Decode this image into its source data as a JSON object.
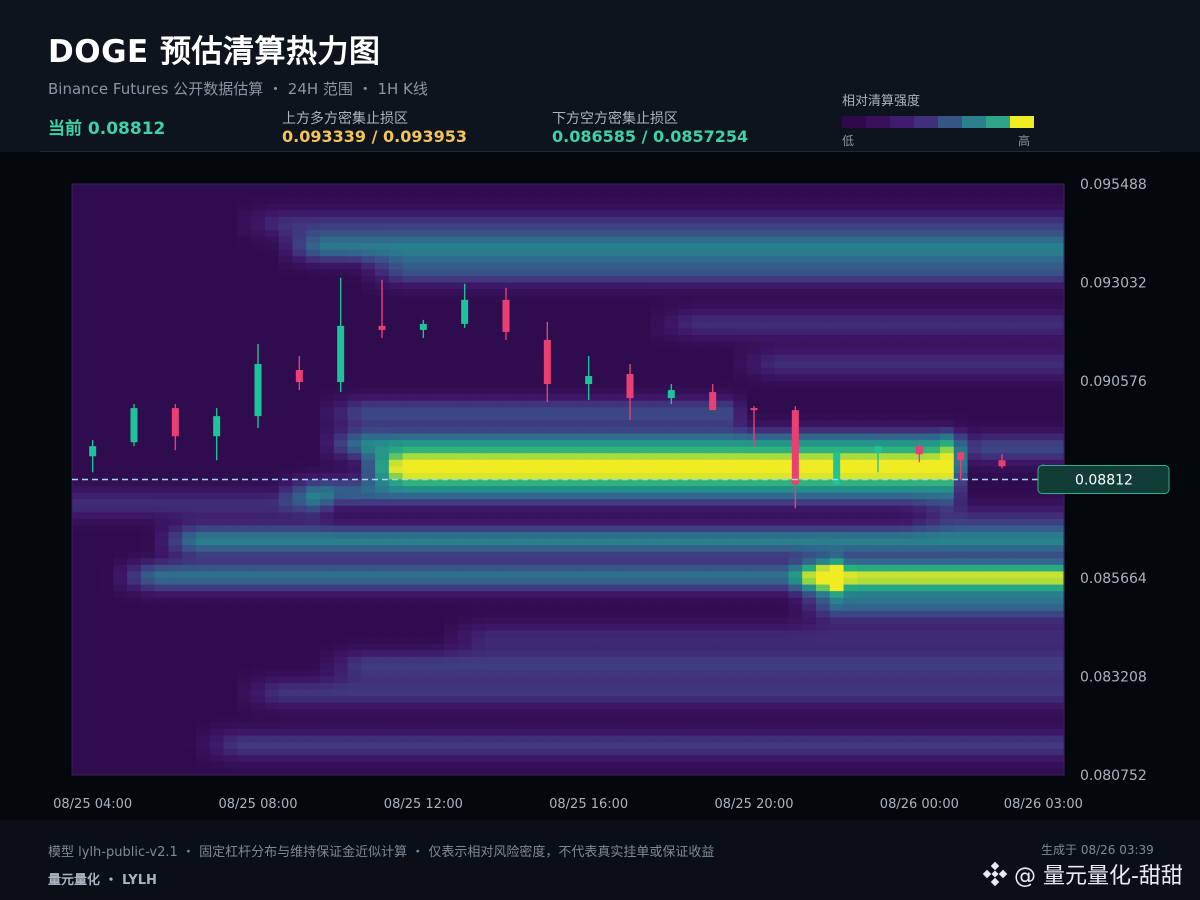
{
  "header": {
    "title": "DOGE 预估清算热力图",
    "subtitle": "Binance Futures 公开数据估算 ・ 24H 范围 ・ 1H K线",
    "current_label": "当前 0.08812",
    "upper_label": "上方多方密集止损区",
    "upper_value": "0.093339 / 0.093953",
    "lower_label": "下方空方密集止损区",
    "lower_value": "0.086585 / 0.0857254"
  },
  "legend": {
    "title": "相对清算强度",
    "low": "低",
    "high": "高",
    "colors": [
      "#2d0a4a",
      "#3a0f5c",
      "#411b6e",
      "#40307c",
      "#365584",
      "#2c7f8c",
      "#2fa488",
      "#f0ee22"
    ]
  },
  "footer": {
    "note": "模型 lylh-public-v2.1 ・ 固定杠杆分布与维持保证金近似计算 ・ 仅表示相对风险密度，不代表真实挂单或保证收益",
    "generated": "生成于 08/26 03:39",
    "brand": "量元量化 ・ LYLH",
    "watermark": "@ 量元量化-甜甜"
  },
  "colors": {
    "up": "#1fc39a",
    "down": "#ea3f72",
    "current_line": "#9fd7e6",
    "upper_value": "#f2c45a",
    "lower_value": "#3fd2a6",
    "price_tag_bg": "#123d36",
    "price_tag_border": "#2fb08e"
  },
  "chart_data": {
    "type": "heatmap",
    "x_ticks": [
      "08/25 04:00",
      "08/25 08:00",
      "08/25 12:00",
      "08/25 16:00",
      "08/25 20:00",
      "08/26 00:00",
      "08/26 03:00"
    ],
    "y_ticks": [
      "0.095488",
      "0.093032",
      "0.090576",
      "0.088120",
      "0.085664",
      "0.083208",
      "0.080752"
    ],
    "ylim": [
      0.080752,
      0.095488
    ],
    "current_price": 0.08812,
    "current_price_label": "0.08812",
    "heat_bands": [
      {
        "price": 0.0884,
        "amp": 1.0,
        "x_from": 8,
        "x_to": 21.3
      },
      {
        "price": 0.089,
        "amp": 0.55,
        "x_from": 7,
        "x_to": 21.3
      },
      {
        "price": 0.0878,
        "amp": 0.45,
        "x_from": 6,
        "x_to": 21.3
      },
      {
        "price": 0.0898,
        "amp": 0.35,
        "x_from": 7,
        "x_to": 16
      },
      {
        "price": 0.0857,
        "amp": 0.92,
        "x_from": 18.5,
        "x_to": 24
      },
      {
        "price": 0.0857,
        "amp": 0.5,
        "x_from": 2,
        "x_to": 18.5
      },
      {
        "price": 0.0866,
        "amp": 0.55,
        "x_from": 3,
        "x_to": 24
      },
      {
        "price": 0.085,
        "amp": 0.45,
        "x_from": 18.5,
        "x_to": 24
      },
      {
        "price": 0.0889,
        "amp": 0.35,
        "x_from": 22,
        "x_to": 24
      },
      {
        "price": 0.0939,
        "amp": 0.5,
        "x_from": 6,
        "x_to": 24
      },
      {
        "price": 0.0933,
        "amp": 0.35,
        "x_from": 8,
        "x_to": 24
      },
      {
        "price": 0.0945,
        "amp": 0.25,
        "x_from": 5,
        "x_to": 24
      },
      {
        "price": 0.092,
        "amp": 0.25,
        "x_from": 15,
        "x_to": 24
      },
      {
        "price": 0.091,
        "amp": 0.25,
        "x_from": 17,
        "x_to": 24
      },
      {
        "price": 0.0835,
        "amp": 0.3,
        "x_from": 7,
        "x_to": 24
      },
      {
        "price": 0.0828,
        "amp": 0.28,
        "x_from": 5,
        "x_to": 24
      },
      {
        "price": 0.0815,
        "amp": 0.3,
        "x_from": 4,
        "x_to": 24
      },
      {
        "price": 0.0842,
        "amp": 0.22,
        "x_from": 10,
        "x_to": 24
      },
      {
        "price": 0.0875,
        "amp": 0.25,
        "x_from": 0,
        "x_to": 6
      },
      {
        "price": 0.0872,
        "amp": 0.2,
        "x_from": 21.3,
        "x_to": 24
      }
    ],
    "candles": [
      {
        "o": 0.0887,
        "h": 0.0891,
        "l": 0.0883,
        "c": 0.08895
      },
      {
        "o": 0.08905,
        "h": 0.09,
        "l": 0.08895,
        "c": 0.0899
      },
      {
        "o": 0.0899,
        "h": 0.09,
        "l": 0.08885,
        "c": 0.0892
      },
      {
        "o": 0.0892,
        "h": 0.0899,
        "l": 0.0886,
        "c": 0.0897
      },
      {
        "o": 0.0897,
        "h": 0.0915,
        "l": 0.0894,
        "c": 0.091
      },
      {
        "o": 0.09085,
        "h": 0.0912,
        "l": 0.09035,
        "c": 0.09055
      },
      {
        "o": 0.09055,
        "h": 0.09315,
        "l": 0.0903,
        "c": 0.09195
      },
      {
        "o": 0.09195,
        "h": 0.0931,
        "l": 0.09165,
        "c": 0.09185
      },
      {
        "o": 0.09185,
        "h": 0.0921,
        "l": 0.09165,
        "c": 0.092
      },
      {
        "o": 0.092,
        "h": 0.093,
        "l": 0.0919,
        "c": 0.0926
      },
      {
        "o": 0.0926,
        "h": 0.0929,
        "l": 0.0916,
        "c": 0.0918
      },
      {
        "o": 0.0916,
        "h": 0.09205,
        "l": 0.09005,
        "c": 0.0905
      },
      {
        "o": 0.0905,
        "h": 0.0912,
        "l": 0.0901,
        "c": 0.0907
      },
      {
        "o": 0.09075,
        "h": 0.091,
        "l": 0.0896,
        "c": 0.09015
      },
      {
        "o": 0.09015,
        "h": 0.0905,
        "l": 0.09,
        "c": 0.09035
      },
      {
        "o": 0.0903,
        "h": 0.0905,
        "l": 0.0899,
        "c": 0.08985
      },
      {
        "o": 0.0899,
        "h": 0.08995,
        "l": 0.08895,
        "c": 0.08985
      },
      {
        "o": 0.08985,
        "h": 0.08995,
        "l": 0.0874,
        "c": 0.088
      },
      {
        "o": 0.088,
        "h": 0.0888,
        "l": 0.088,
        "c": 0.0888
      },
      {
        "o": 0.0888,
        "h": 0.08895,
        "l": 0.0883,
        "c": 0.08895
      },
      {
        "o": 0.08895,
        "h": 0.08905,
        "l": 0.08855,
        "c": 0.08875
      },
      {
        "o": 0.0888,
        "h": 0.0888,
        "l": 0.0881,
        "c": 0.0886
      },
      {
        "o": 0.0886,
        "h": 0.08875,
        "l": 0.0884,
        "c": 0.08845
      },
      {
        "o": 0.08845,
        "h": 0.0885,
        "l": 0.08815,
        "c": 0.08815
      }
    ]
  }
}
